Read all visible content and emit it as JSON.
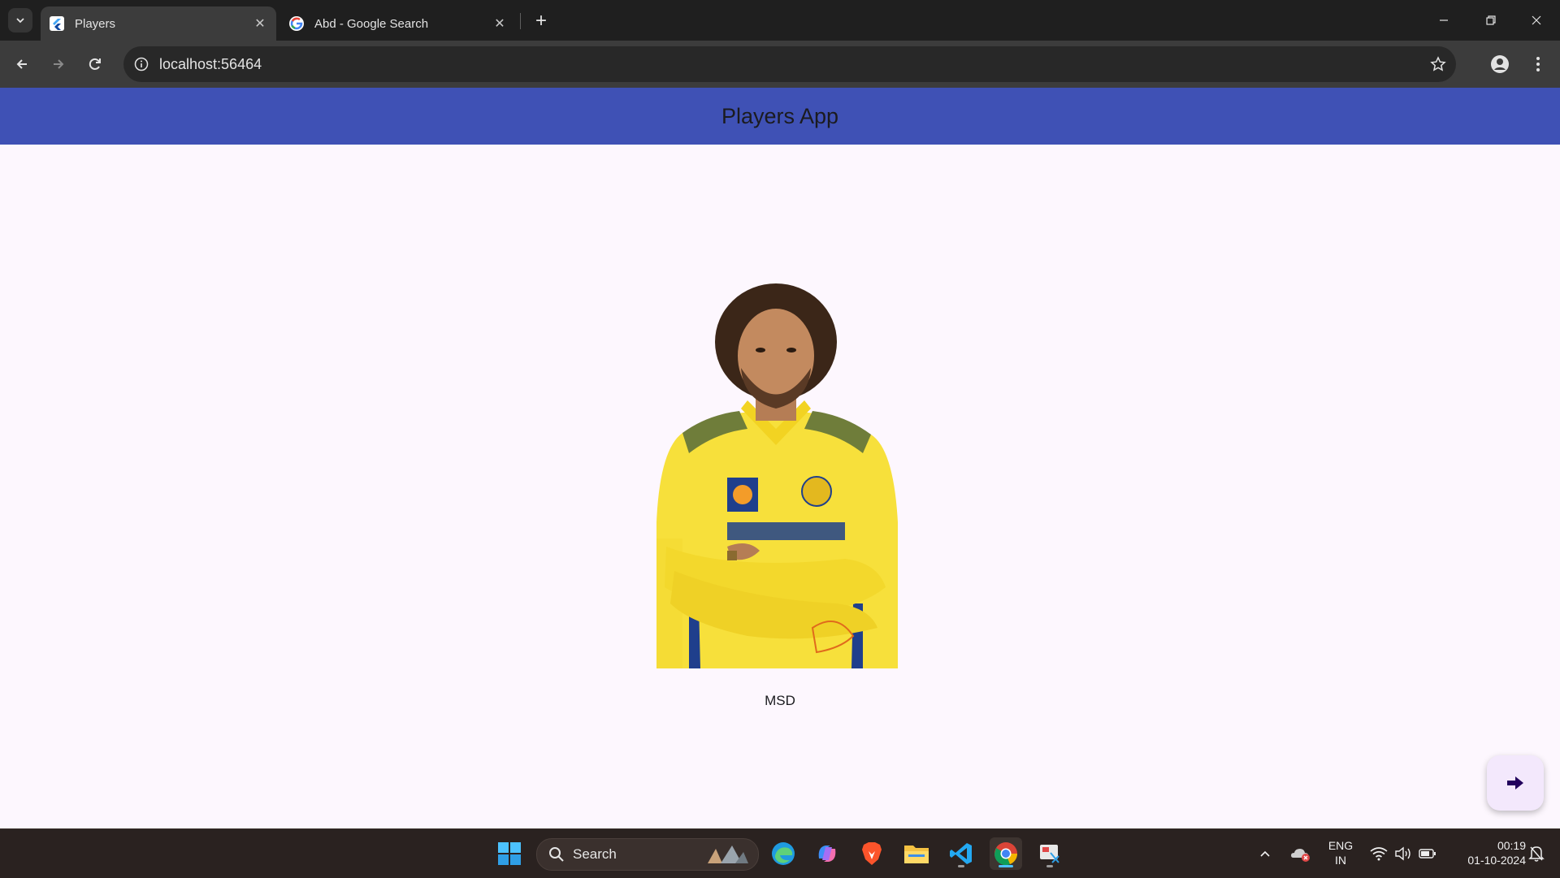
{
  "browser": {
    "tabs": [
      {
        "title": "Players",
        "active": true
      },
      {
        "title": "Abd - Google Search",
        "active": false
      }
    ],
    "address": "localhost:56464"
  },
  "app": {
    "title": "Players App",
    "player": {
      "name": "MSD"
    },
    "fab_icon": "arrow-right-icon",
    "colors": {
      "appbar": "#3f51b5",
      "background": "#fdf7fe",
      "fab": "#f3e8fc"
    }
  },
  "taskbar": {
    "search_label": "Search",
    "language_top": "ENG",
    "language_bottom": "IN",
    "time": "00:19",
    "date": "01-10-2024"
  }
}
